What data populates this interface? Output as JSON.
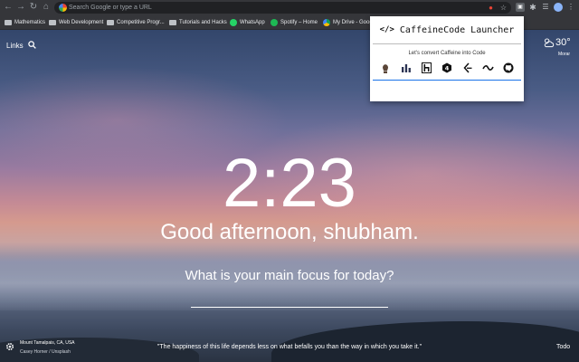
{
  "browser": {
    "omnibox_placeholder": "Search Google or type a URL",
    "bookmarks": [
      {
        "label": "Mathematics",
        "icon": "folder-icon"
      },
      {
        "label": "Web Development",
        "icon": "folder-icon"
      },
      {
        "label": "Competitive Progr...",
        "icon": "folder-icon"
      },
      {
        "label": "Tutorials and Hacks",
        "icon": "folder-icon"
      },
      {
        "label": "WhatsApp",
        "icon": "whatsapp-icon"
      },
      {
        "label": "Spotify – Home",
        "icon": "spotify-icon"
      },
      {
        "label": "My Drive - Goog",
        "icon": "drive-icon"
      }
    ]
  },
  "dashboard": {
    "links_label": "Links",
    "weather": {
      "temp": "30°",
      "location": "Morar",
      "icon": "partly-cloudy-icon"
    },
    "clock": "2:23",
    "greeting": "Good afternoon, shubham.",
    "focus_prompt": "What is your main focus for today?",
    "photo_location": "Mount Tamalpais, CA, USA",
    "photo_credit": "Casey Horner / Unsplash",
    "quote": "\"The happiness of this life depends less on what befalls you than the way in which you take it.\"",
    "todo_label": "Todo"
  },
  "popup": {
    "title": "CaffeineCode Launcher",
    "title_icon": "</>",
    "subtitle": "Let's convert Caffeine into Code",
    "sites": [
      "codechef-icon",
      "hackerearth-icon",
      "hackerrank-icon",
      "hackerblocks-icon",
      "leetcode-icon",
      "spoj-icon",
      "github-icon"
    ]
  },
  "colors": {
    "chrome_bg": "#35363a",
    "omnibox_bg": "#202124",
    "accent": "#1a73e8",
    "whatsapp": "#25d366",
    "spotify": "#1db954"
  }
}
